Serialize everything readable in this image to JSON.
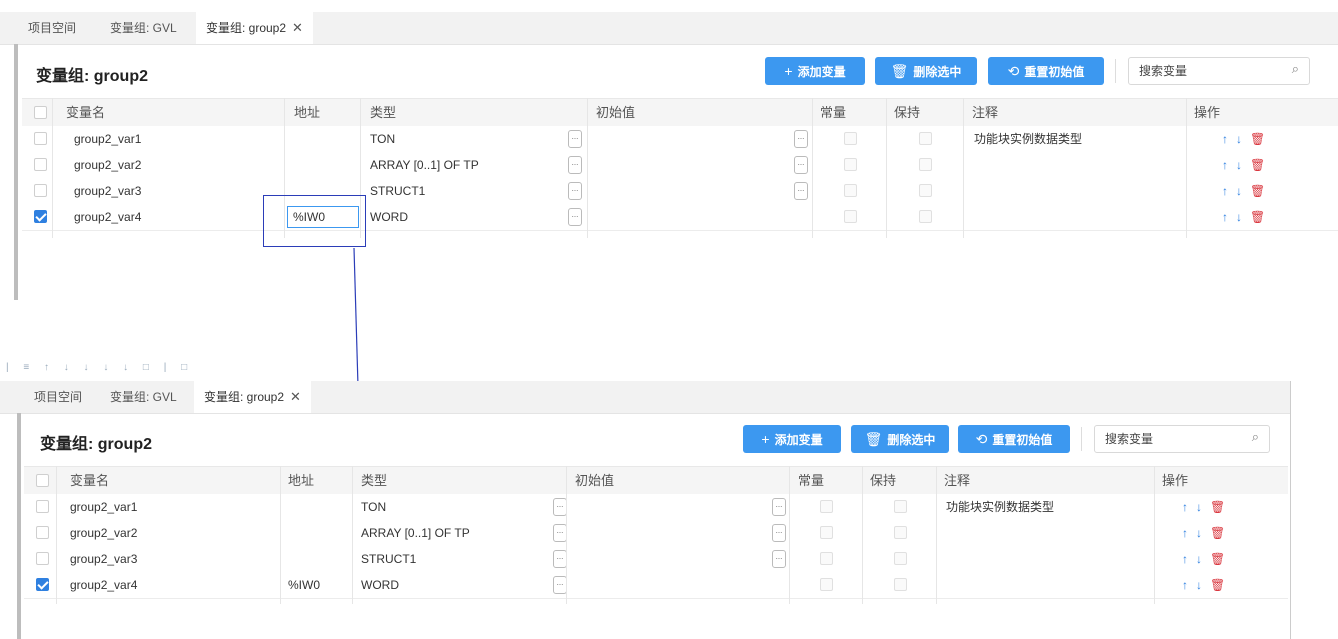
{
  "tabs": [
    {
      "label": "项目空间"
    },
    {
      "label": "变量组: GVL"
    },
    {
      "label": "变量组: group2"
    }
  ],
  "close_glyph": "✕",
  "title": "变量组: group2",
  "buttons": {
    "add": {
      "icon": "+",
      "label": "添加变量"
    },
    "delete": {
      "icon": "🗑",
      "label": "删除选中"
    },
    "reset": {
      "icon": "⟲",
      "label": "重置初始值"
    }
  },
  "search": {
    "placeholder": "搜索变量",
    "icon": "search-icon"
  },
  "columns": {
    "name": "变量名",
    "address": "地址",
    "type": "类型",
    "initial": "初始值",
    "constant": "常量",
    "retain": "保持",
    "comment": "注释",
    "actions": "操作"
  },
  "rows_before": [
    {
      "name": "group2_var1",
      "address": "",
      "type": "TON",
      "comment": "功能块实例数据类型",
      "checked": false
    },
    {
      "name": "group2_var2",
      "address": "",
      "type": "ARRAY [0..1] OF TP",
      "comment": "",
      "checked": false
    },
    {
      "name": "group2_var3",
      "address": "",
      "type": "STRUCT1",
      "comment": "",
      "checked": false
    },
    {
      "name": "group2_var4",
      "address": "%IW0",
      "type": "WORD",
      "comment": "",
      "checked": true
    }
  ],
  "rows_after": [
    {
      "name": "group2_var1",
      "address": "",
      "type": "TON",
      "comment": "功能块实例数据类型",
      "checked": false
    },
    {
      "name": "group2_var2",
      "address": "",
      "type": "ARRAY [0..1] OF TP",
      "comment": "",
      "checked": false
    },
    {
      "name": "group2_var3",
      "address": "",
      "type": "STRUCT1",
      "comment": "",
      "checked": false
    },
    {
      "name": "group2_var4",
      "address": "%IW0",
      "type": "WORD",
      "comment": "",
      "checked": true
    }
  ],
  "ellipsis": "...",
  "ops": {
    "up": "↑",
    "down": "↓",
    "delete": "🗑"
  },
  "annotation_color": "#2b3db8",
  "accent": "#3c98f0"
}
